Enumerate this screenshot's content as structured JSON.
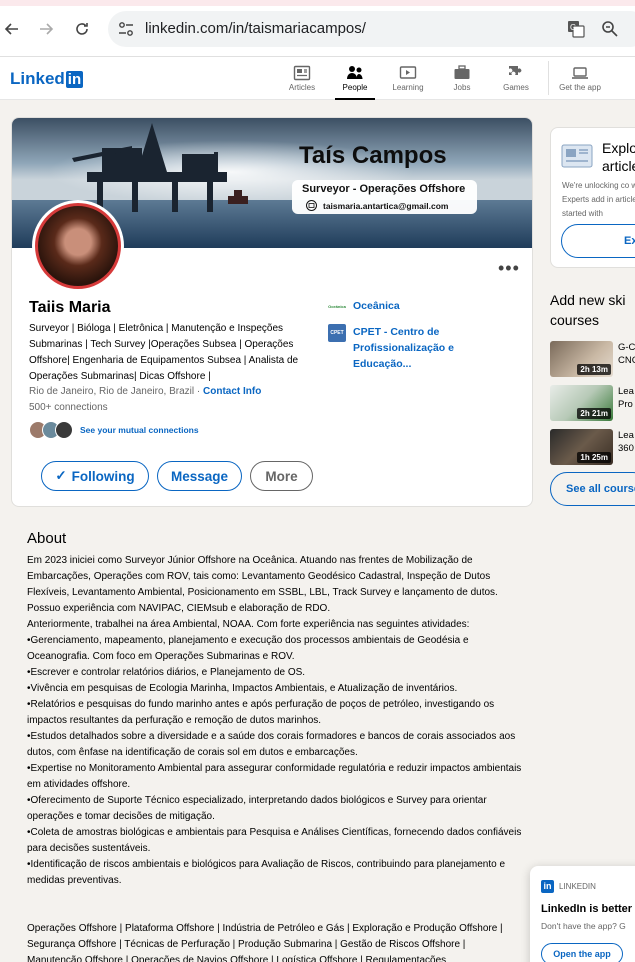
{
  "browser": {
    "url": "linkedin.com/in/taismariacampos/"
  },
  "header": {
    "logo_text": "Linked",
    "logo_in": "in",
    "nav": [
      {
        "label": "Articles",
        "icon": "articles-icon"
      },
      {
        "label": "People",
        "icon": "people-icon"
      },
      {
        "label": "Learning",
        "icon": "learning-icon"
      },
      {
        "label": "Jobs",
        "icon": "jobs-icon"
      },
      {
        "label": "Games",
        "icon": "games-icon"
      },
      {
        "label": "Get the app",
        "icon": "laptop-icon"
      }
    ]
  },
  "banner": {
    "name": "Taís Campos",
    "role": "Surveyor - Operações Offshore",
    "email": "taismaria.antartica@gmail.com"
  },
  "profile": {
    "name": "Taiis Maria",
    "headline": "Surveyor | Bióloga | Eletrônica | Manutenção e Inspeções Submarinas | Tech Survey |Operações Subsea | Operações Offshore| Engenharia de Equipamentos Subsea | Analista de Operações Submarinas| Dicas Offshore |",
    "location": "Rio de Janeiro, Rio de Janeiro, Brazil",
    "separator": "·",
    "contact_info": "Contact Info",
    "connections": "500+ connections",
    "mutual": "See your mutual connections",
    "buttons": {
      "following": "Following",
      "following_check": "✓",
      "message": "Message",
      "more": "More"
    },
    "more_dots": "•••",
    "experience": [
      {
        "name": "Oceânica",
        "logo_text": "Oceânica"
      },
      {
        "name": "CPET - Centro de Profissionalização e Educação...",
        "logo_text": "CPET"
      }
    ]
  },
  "about": {
    "title": "About",
    "paragraphs": [
      "Em 2023 iniciei como Surveyor Júnior Offshore na Oceânica. Atuando nas frentes de Mobilização de Embarcações, Operações com ROV, tais como: Levantamento Geodésico Cadastral, Inspeção de Dutos Flexíveis, Levantamento Ambiental, Posicionamento em SSBL, LBL, Track Survey e lançamento de dutos. Possuo experiência com NAVIPAC, CIEMsub e elaboração de RDO.",
      "Anteriormente, trabalhei na área Ambiental, NOAA. Com forte experiência nas seguintes atividades:",
      "•Gerenciamento, mapeamento, planejamento e execução dos processos ambientais de Geodésia e Oceanografia. Com foco em Operações Submarinas e ROV.",
      "•Escrever e controlar relatórios diários, e Planejamento de OS.",
      "•Vivência em pesquisas de Ecologia Marinha, Impactos Ambientais, e Atualização de inventários.",
      "•Relatórios e pesquisas do fundo marinho antes e após perfuração de poços de petróleo, investigando os impactos resultantes da perfuração e remoção de dutos marinhos.",
      "•Estudos detalhados sobre a diversidade e a saúde dos corais formadores e bancos de corais associados aos dutos, com ênfase na identificação de corais sol em dutos e embarcações.",
      "•Expertise no Monitoramento Ambiental para assegurar conformidade regulatória e reduzir impactos ambientais em atividades offshore.",
      "•Oferecimento de Suporte Técnico especializado, interpretando dados biológicos e Survey para orientar operações e tomar decisões de mitigação.",
      "•Coleta de amostras biológicas e ambientais para Pesquisa e Análises Científicas, fornecendo dados confiáveis para decisões sustentáveis.",
      "•Identificação de riscos ambientais e biológicos para Avaliação de Riscos, contribuindo para planejamento e medidas preventivas."
    ],
    "tags": "Operações Offshore | Plataforma Offshore | Indústria de Petróleo e Gás | Exploração e Produção Offshore | Segurança Offshore | Técnicas de Perfuração | Produção Submarina | Gestão de Riscos Offshore | Manutenção Offshore | Operações de Navios Offshore | Logística Offshore | Regulamentações"
  },
  "sidebar": {
    "explore_title": "Explo",
    "explore_title2": "article",
    "explore_body": "We're unlocking co way. Experts add in article, started with",
    "explore_button": "Ex",
    "skills_title": "Add new ski courses",
    "courses": [
      {
        "duration": "2h 13m",
        "line1": "G-C",
        "line2": "CNC"
      },
      {
        "duration": "2h 21m",
        "line1": "Lea",
        "line2": "Pro"
      },
      {
        "duration": "1h 25m",
        "line1": "Lea",
        "line2": "360"
      }
    ],
    "see_all": "See all courses"
  },
  "popup": {
    "brand": "LINKEDIN",
    "title": "LinkedIn is better o",
    "subtitle": "Don't have the app? G",
    "button": "Open the app"
  }
}
